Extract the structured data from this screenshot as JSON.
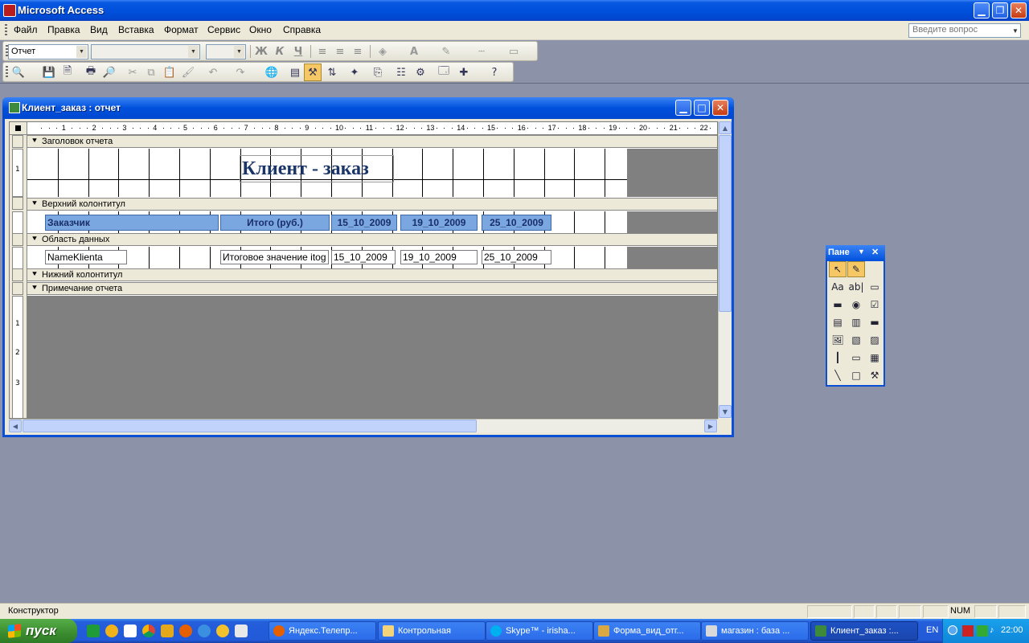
{
  "app": {
    "title": "Microsoft Access"
  },
  "menu": {
    "items": [
      "Файл",
      "Правка",
      "Вид",
      "Вставка",
      "Формат",
      "Сервис",
      "Окно",
      "Справка"
    ],
    "help_placeholder": "Введите вопрос"
  },
  "format_toolbar": {
    "object_combo": "Отчет",
    "bold": "Ж",
    "italic": "К",
    "underline": "Ч",
    "font_color": "A"
  },
  "report_window": {
    "title": "Клиент_заказ : отчет",
    "ruler_numbers": [
      "1",
      "2",
      "3",
      "4",
      "5",
      "6",
      "7",
      "8",
      "9",
      "10",
      "11",
      "12",
      "13",
      "14",
      "15",
      "16",
      "17",
      "18",
      "19",
      "20",
      "21",
      "22"
    ],
    "vruler_numbers": [
      "1",
      "1",
      "2",
      "3"
    ],
    "sections": {
      "report_header": "Заголовок отчета",
      "page_header": "Верхний колонтитул",
      "detail": "Область данных",
      "page_footer": "Нижний колонтитул",
      "report_footer": "Примечание отчета"
    },
    "report_title": "Клиент - заказ",
    "header_labels": [
      "Заказчик",
      "Итого (руб.)",
      "15_10_2009",
      "19_10_2009",
      "25_10_2009"
    ],
    "detail_fields": [
      "NameKlienta",
      "Итоговое значение itog",
      "15_10_2009",
      "19_10_2009",
      "25_10_2009"
    ]
  },
  "toolbox": {
    "title": "Пане",
    "tools": [
      "select-tool",
      "wizard-tool",
      "label-tool",
      "textbox-tool",
      "option-group-tool",
      "toggle-tool",
      "option-button-tool",
      "checkbox-tool",
      "combobox-tool",
      "listbox-tool",
      "command-button-tool",
      "image-tool",
      "unbound-object-tool",
      "bound-object-tool",
      "page-break-tool",
      "tab-control-tool",
      "subform-tool",
      "line-tool",
      "rectangle-tool",
      "more-controls-tool"
    ]
  },
  "statusbar": {
    "mode": "Конструктор",
    "num": "NUM"
  },
  "taskbar": {
    "start": "пуск",
    "tasks": [
      "Яндекс.Телепр...",
      "Контрольная",
      "Skype™ - irisha...",
      "Форма_вид_отг...",
      "магазин : база ...",
      "Клиент_заказ :..."
    ],
    "lang": "EN",
    "clock": "22:00"
  },
  "colors": {
    "xp_blue": "#0050dc",
    "header_label_bg": "#7ba7e1",
    "title_text": "#1a3567",
    "workspace": "#8c92a8"
  }
}
